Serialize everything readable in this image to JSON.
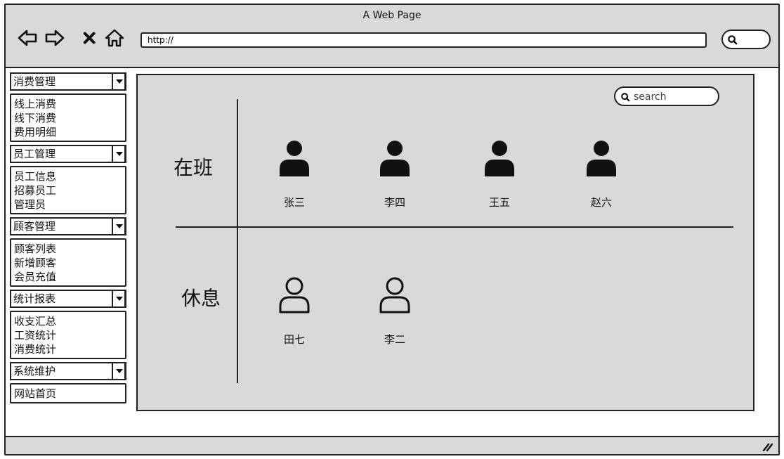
{
  "window": {
    "title": "A Web Page"
  },
  "browser": {
    "url": "http://",
    "nav_icons": [
      "back-arrow-icon",
      "forward-arrow-icon",
      "close-icon",
      "home-icon"
    ]
  },
  "sidebar": {
    "groups": [
      {
        "label": "消费管理",
        "items": [
          "线上消费",
          "线下消费",
          "费用明细"
        ]
      },
      {
        "label": "员工管理",
        "items": [
          "员工信息",
          "招募员工",
          "管理员"
        ]
      },
      {
        "label": "顾客管理",
        "items": [
          "顾客列表",
          "新增顾客",
          "会员充值"
        ]
      },
      {
        "label": "统计报表",
        "items": [
          "收支汇总",
          "工资统计",
          "消费统计"
        ]
      },
      {
        "label": "系统维护",
        "items": [
          "网站首页"
        ]
      }
    ]
  },
  "main": {
    "search_placeholder": "search",
    "on_duty": {
      "label": "在班",
      "people": [
        "张三",
        "李四",
        "王五",
        "赵六"
      ]
    },
    "resting": {
      "label": "休息",
      "people": [
        "田七",
        "李二"
      ]
    }
  },
  "colors": {
    "chrome_bg": "#d9d9d9",
    "panel_bg": "#d9d9d9",
    "stroke": "#222222"
  }
}
